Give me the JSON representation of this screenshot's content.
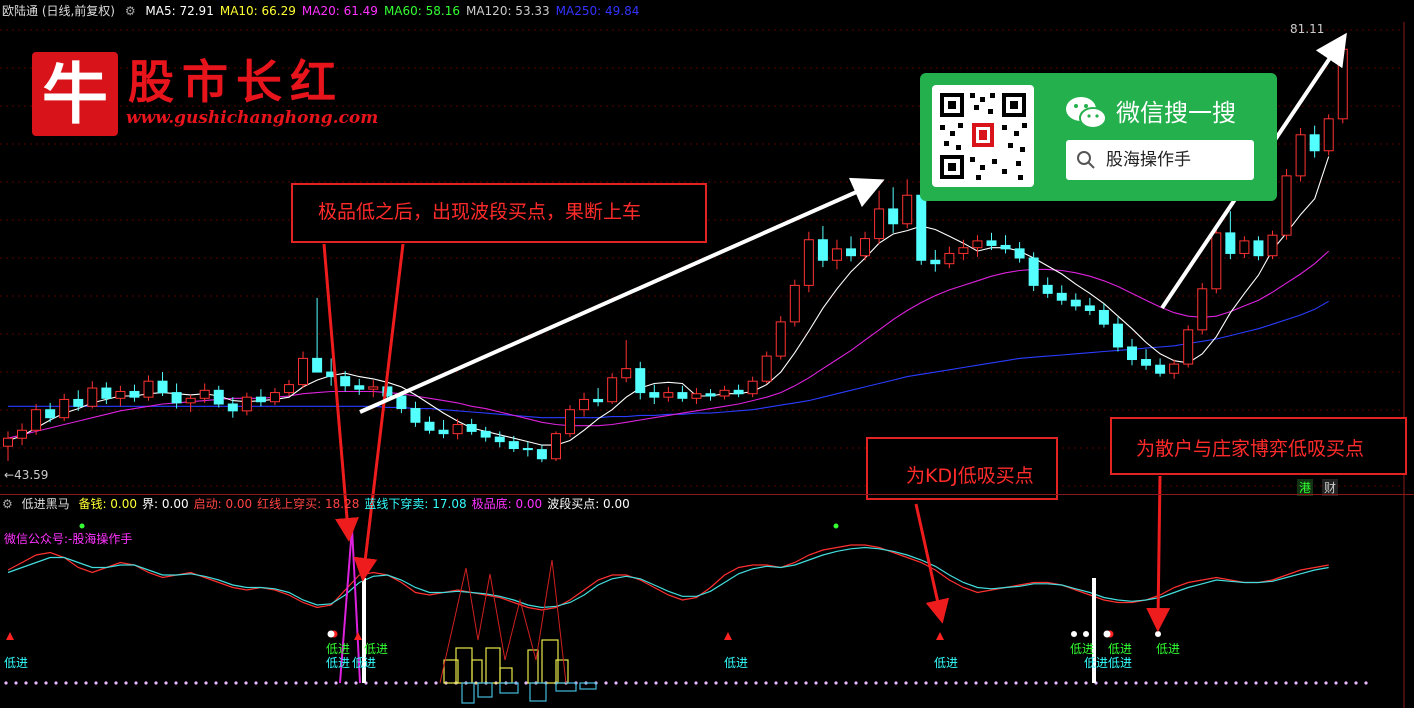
{
  "header": {
    "title": "欧陆通 (日线,前复权)",
    "ma": [
      {
        "label": "MA5: 72.91",
        "color": "#ffffff"
      },
      {
        "label": "MA10: 66.29",
        "color": "#ffff33"
      },
      {
        "label": "MA20: 61.49",
        "color": "#ff33ff"
      },
      {
        "label": "MA60: 58.16",
        "color": "#33ff33"
      },
      {
        "label": "MA120: 53.33",
        "color": "#cccccc"
      },
      {
        "label": "MA250: 49.84",
        "color": "#3333ff"
      }
    ]
  },
  "logo": {
    "mark": "牛",
    "title": "股市长红",
    "url": "www.gushichanghong.com"
  },
  "wechat": {
    "title": "微信搜一搜",
    "search_text": "股海操作手"
  },
  "notes": {
    "main": "极品低之后，出现波段买点，果断上车",
    "kdj": "为KDJ低吸买点",
    "game": "为散户与庄家博弈低吸买点"
  },
  "price_marks": {
    "high": "81.11",
    "low": "43.59"
  },
  "tags": {
    "hk": "港",
    "fin": "财"
  },
  "indicator": {
    "name": "低进黑马",
    "fields": [
      {
        "label": "备钱: 0.00",
        "color": "#ffff33"
      },
      {
        "label": "界: 0.00",
        "color": "#ffffff"
      },
      {
        "label": "启动: 0.00",
        "color": "#ff4444"
      },
      {
        "label": "红线上穿买: 18.28",
        "color": "#ff4444"
      },
      {
        "label": "蓝线下穿卖: 17.08",
        "color": "#33ffff"
      },
      {
        "label": "极品底: 0.00",
        "color": "#ff33ff"
      },
      {
        "label": "波段买点: 0.00",
        "color": "#ffffff"
      }
    ],
    "wechat_label": "微信公众号:-股海操作手",
    "low_label": "低进"
  },
  "colors": {
    "up": "#ff3232",
    "down": "#54ffff",
    "note": "#e32222"
  },
  "chart_data": {
    "type": "candlestick",
    "y_range": [
      43.59,
      81.11
    ],
    "candles": [
      [
        45.5,
        46.8,
        44.2,
        46.2
      ],
      [
        46.2,
        47.5,
        45.6,
        46.9
      ],
      [
        46.9,
        49.2,
        46.5,
        48.7
      ],
      [
        48.7,
        49.3,
        47.6,
        48.0
      ],
      [
        48.0,
        50.1,
        47.7,
        49.6
      ],
      [
        49.6,
        50.4,
        48.6,
        49.0
      ],
      [
        49.0,
        51.2,
        48.8,
        50.6
      ],
      [
        50.6,
        51.1,
        49.2,
        49.7
      ],
      [
        49.7,
        50.8,
        49.0,
        50.3
      ],
      [
        50.3,
        50.9,
        49.4,
        49.8
      ],
      [
        49.8,
        51.7,
        49.5,
        51.2
      ],
      [
        51.2,
        52.0,
        49.9,
        50.2
      ],
      [
        50.2,
        51.0,
        48.8,
        49.3
      ],
      [
        49.3,
        50.0,
        48.5,
        49.7
      ],
      [
        49.7,
        51.0,
        49.3,
        50.4
      ],
      [
        50.4,
        50.8,
        48.9,
        49.2
      ],
      [
        49.2,
        49.8,
        48.0,
        48.6
      ],
      [
        48.6,
        50.2,
        48.2,
        49.8
      ],
      [
        49.8,
        50.5,
        49.0,
        49.4
      ],
      [
        49.4,
        50.6,
        49.1,
        50.2
      ],
      [
        50.2,
        51.3,
        49.9,
        50.9
      ],
      [
        50.9,
        53.8,
        50.6,
        53.2
      ],
      [
        53.2,
        58.5,
        52.6,
        52.0
      ],
      [
        52.0,
        53.2,
        50.8,
        51.6
      ],
      [
        51.6,
        52.1,
        50.3,
        50.8
      ],
      [
        50.8,
        51.4,
        50.0,
        50.5
      ],
      [
        50.5,
        51.3,
        49.8,
        50.7
      ],
      [
        50.7,
        51.1,
        49.5,
        49.9
      ],
      [
        49.9,
        50.3,
        48.4,
        48.8
      ],
      [
        48.8,
        49.4,
        47.2,
        47.6
      ],
      [
        47.6,
        48.1,
        46.6,
        46.9
      ],
      [
        46.9,
        47.8,
        46.2,
        46.6
      ],
      [
        46.6,
        47.9,
        46.1,
        47.4
      ],
      [
        47.4,
        47.9,
        46.5,
        46.8
      ],
      [
        46.8,
        47.2,
        45.9,
        46.3
      ],
      [
        46.3,
        46.8,
        45.4,
        45.9
      ],
      [
        45.9,
        46.4,
        45.0,
        45.3
      ],
      [
        45.3,
        45.9,
        44.6,
        45.2
      ],
      [
        45.2,
        45.6,
        44.1,
        44.4
      ],
      [
        44.4,
        46.8,
        44.2,
        46.6
      ],
      [
        46.6,
        49.1,
        46.3,
        48.7
      ],
      [
        48.7,
        50.2,
        48.1,
        49.6
      ],
      [
        49.6,
        50.6,
        49.0,
        49.4
      ],
      [
        49.4,
        51.9,
        49.2,
        51.5
      ],
      [
        51.5,
        54.8,
        51.1,
        52.3
      ],
      [
        52.3,
        52.9,
        49.6,
        50.2
      ],
      [
        50.2,
        50.9,
        49.2,
        49.8
      ],
      [
        49.8,
        50.7,
        49.4,
        50.2
      ],
      [
        50.2,
        50.8,
        49.4,
        49.7
      ],
      [
        49.7,
        50.6,
        49.2,
        50.1
      ],
      [
        50.1,
        50.5,
        49.5,
        49.9
      ],
      [
        49.9,
        50.8,
        49.6,
        50.4
      ],
      [
        50.4,
        50.9,
        49.8,
        50.1
      ],
      [
        50.1,
        51.6,
        49.8,
        51.2
      ],
      [
        51.2,
        53.8,
        51.0,
        53.4
      ],
      [
        53.4,
        56.9,
        53.1,
        56.4
      ],
      [
        56.4,
        60.1,
        56.0,
        59.6
      ],
      [
        59.6,
        64.3,
        59.0,
        63.6
      ],
      [
        63.6,
        64.8,
        61.2,
        61.8
      ],
      [
        61.8,
        63.6,
        61.0,
        62.8
      ],
      [
        62.8,
        63.9,
        61.7,
        62.2
      ],
      [
        62.2,
        64.3,
        61.8,
        63.7
      ],
      [
        63.7,
        67.9,
        63.2,
        66.3
      ],
      [
        66.3,
        68.2,
        64.2,
        65.0
      ],
      [
        65.0,
        68.9,
        64.6,
        67.5
      ],
      [
        67.5,
        68.3,
        61.4,
        61.8
      ],
      [
        61.8,
        62.7,
        60.8,
        61.5
      ],
      [
        61.5,
        63.0,
        61.1,
        62.4
      ],
      [
        62.4,
        63.6,
        61.8,
        62.9
      ],
      [
        62.9,
        64.0,
        62.1,
        63.5
      ],
      [
        63.5,
        64.2,
        62.7,
        63.1
      ],
      [
        63.1,
        64.0,
        62.4,
        62.8
      ],
      [
        62.8,
        63.4,
        61.6,
        62.0
      ],
      [
        62.0,
        62.5,
        59.1,
        59.6
      ],
      [
        59.6,
        60.3,
        58.5,
        58.9
      ],
      [
        58.9,
        59.6,
        57.9,
        58.3
      ],
      [
        58.3,
        58.9,
        57.4,
        57.8
      ],
      [
        57.8,
        58.5,
        57.0,
        57.4
      ],
      [
        57.4,
        58.0,
        55.9,
        56.2
      ],
      [
        56.2,
        56.8,
        53.8,
        54.2
      ],
      [
        54.2,
        54.9,
        52.6,
        53.1
      ],
      [
        53.1,
        54.0,
        52.2,
        52.6
      ],
      [
        52.6,
        53.2,
        51.6,
        51.9
      ],
      [
        51.9,
        53.1,
        51.4,
        52.7
      ],
      [
        52.7,
        56.1,
        52.4,
        55.7
      ],
      [
        55.7,
        59.8,
        55.3,
        59.3
      ],
      [
        59.3,
        64.7,
        58.9,
        64.2
      ],
      [
        64.2,
        66.1,
        61.9,
        62.4
      ],
      [
        62.4,
        63.9,
        62.0,
        63.5
      ],
      [
        63.5,
        63.9,
        61.8,
        62.2
      ],
      [
        62.2,
        64.4,
        61.9,
        64.0
      ],
      [
        64.0,
        69.8,
        63.6,
        69.2
      ],
      [
        69.2,
        73.4,
        68.7,
        72.8
      ],
      [
        72.8,
        73.6,
        70.8,
        71.4
      ],
      [
        71.4,
        74.6,
        71.0,
        74.2
      ],
      [
        74.2,
        81.1,
        73.8,
        80.3
      ]
    ],
    "ma": {
      "ma5": [
        46.0,
        46.4,
        47.1,
        47.8,
        48.4,
        48.8,
        49.3,
        49.6,
        49.9,
        49.9,
        50.1,
        50.2,
        50.1,
        50.0,
        50.1,
        49.9,
        49.5,
        49.4,
        49.5,
        49.6,
        49.8,
        50.7,
        51.3,
        51.7,
        51.9,
        51.6,
        51.4,
        51.1,
        50.7,
        50.0,
        49.2,
        48.4,
        47.7,
        47.1,
        46.8,
        46.5,
        46.2,
        45.9,
        45.6,
        45.6,
        46.0,
        46.9,
        47.9,
        48.7,
        49.8,
        50.6,
        51.0,
        51.1,
        51.0,
        49.9,
        49.9,
        50.1,
        50.1,
        50.3,
        50.9,
        52.0,
        53.7,
        55.6,
        57.6,
        59.3,
        60.8,
        62.0,
        63.3,
        64.1,
        64.4,
        64.8,
        64.5,
        63.9,
        63.3,
        62.6,
        62.9,
        62.9,
        62.6,
        62.0,
        61.3,
        60.6,
        59.7,
        58.9,
        58.0,
        56.9,
        55.8,
        54.6,
        53.6,
        53.0,
        52.8,
        53.6,
        55.1,
        57.2,
        58.9,
        60.5,
        62.7,
        64.2,
        65.8,
        67.2,
        70.9
      ],
      "ma20": [
        46.2,
        46.5,
        46.8,
        47.1,
        47.4,
        47.7,
        48.0,
        48.3,
        48.6,
        48.8,
        49.0,
        49.2,
        49.3,
        49.4,
        49.5,
        49.6,
        49.7,
        49.7,
        49.7,
        49.8,
        49.9,
        50.1,
        50.2,
        50.3,
        50.3,
        50.3,
        50.3,
        50.2,
        50.1,
        49.9,
        49.7,
        49.5,
        49.3,
        49.0,
        48.8,
        48.5,
        48.2,
        47.9,
        47.6,
        47.4,
        47.3,
        47.3,
        47.3,
        47.4,
        47.6,
        47.8,
        48.0,
        48.2,
        48.4,
        48.6,
        48.8,
        49.0,
        49.2,
        49.5,
        49.8,
        50.2,
        50.8,
        51.5,
        52.3,
        53.1,
        53.9,
        54.8,
        55.7,
        56.6,
        57.4,
        58.1,
        58.7,
        59.2,
        59.6,
        60.0,
        60.4,
        60.7,
        60.9,
        61.0,
        61.0,
        60.9,
        60.7,
        60.4,
        60.0,
        59.5,
        58.9,
        58.3,
        57.7,
        57.2,
        56.9,
        56.8,
        56.9,
        57.3,
        57.8,
        58.3,
        59.0,
        59.8,
        60.6,
        61.5,
        62.6
      ],
      "ma60": [
        49.0,
        49.0,
        49.0,
        49.0,
        49.0,
        49.0,
        49.0,
        49.0,
        49.0,
        49.0,
        49.0,
        49.0,
        49.0,
        49.0,
        49.0,
        49.0,
        49.0,
        49.0,
        49.0,
        49.0,
        49.0,
        49.0,
        49.0,
        49.0,
        49.0,
        49.0,
        49.0,
        48.9,
        48.9,
        48.8,
        48.8,
        48.7,
        48.6,
        48.5,
        48.4,
        48.3,
        48.2,
        48.1,
        48.0,
        48.0,
        48.0,
        48.0,
        48.0,
        48.1,
        48.1,
        48.2,
        48.2,
        48.3,
        48.3,
        48.4,
        48.4,
        48.5,
        48.6,
        48.7,
        48.9,
        49.1,
        49.3,
        49.5,
        49.8,
        50.1,
        50.4,
        50.7,
        51.0,
        51.3,
        51.6,
        51.8,
        52.0,
        52.2,
        52.4,
        52.6,
        52.8,
        53.0,
        53.2,
        53.3,
        53.4,
        53.5,
        53.6,
        53.7,
        53.8,
        53.9,
        54.0,
        54.1,
        54.2,
        54.3,
        54.5,
        54.7,
        54.9,
        55.2,
        55.5,
        55.8,
        56.2,
        56.6,
        57.0,
        57.5,
        58.2
      ]
    },
    "kdj": {
      "k": [
        60,
        66,
        72,
        74,
        70,
        62,
        58,
        62,
        66,
        64,
        58,
        54,
        56,
        58,
        54,
        50,
        46,
        44,
        46,
        44,
        40,
        34,
        30,
        32,
        44,
        56,
        58,
        56,
        50,
        42,
        40,
        42,
        44,
        42,
        40,
        38,
        34,
        30,
        28,
        30,
        36,
        44,
        52,
        56,
        56,
        52,
        46,
        40,
        36,
        38,
        46,
        56,
        62,
        64,
        64,
        62,
        66,
        72,
        76,
        78,
        80,
        80,
        78,
        74,
        70,
        66,
        60,
        52,
        46,
        42,
        44,
        46,
        48,
        50,
        50,
        48,
        44,
        40,
        36,
        34,
        34,
        36,
        40,
        46,
        50,
        52,
        54,
        52,
        50,
        50,
        52,
        56,
        60,
        62,
        64
      ],
      "d": [
        58,
        62,
        66,
        70,
        70,
        66,
        62,
        62,
        64,
        64,
        60,
        56,
        56,
        57,
        55,
        52,
        48,
        46,
        46,
        45,
        42,
        36,
        32,
        33,
        40,
        50,
        55,
        56,
        52,
        46,
        42,
        42,
        43,
        42,
        41,
        39,
        36,
        32,
        30,
        31,
        34,
        40,
        48,
        53,
        55,
        53,
        48,
        43,
        39,
        39,
        43,
        50,
        57,
        61,
        63,
        62,
        64,
        68,
        72,
        75,
        77,
        78,
        77,
        75,
        72,
        68,
        63,
        56,
        50,
        46,
        45,
        46,
        47,
        49,
        49,
        48,
        45,
        42,
        38,
        36,
        35,
        36,
        38,
        42,
        46,
        49,
        52,
        51,
        50,
        50,
        51,
        54,
        57,
        60,
        62
      ]
    }
  }
}
